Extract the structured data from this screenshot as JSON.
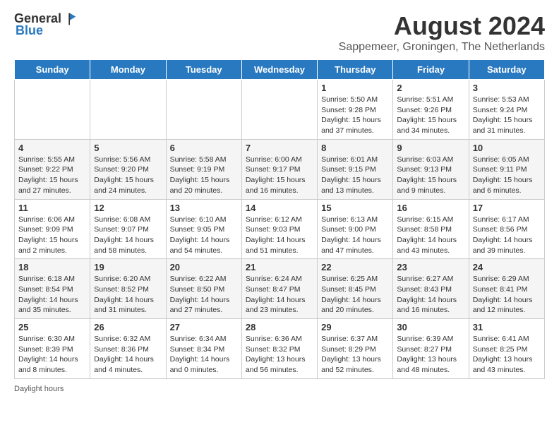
{
  "app": {
    "name": "GeneralBlue",
    "logo_general": "General",
    "logo_blue": "Blue"
  },
  "header": {
    "month_year": "August 2024",
    "location": "Sappemeer, Groningen, The Netherlands"
  },
  "days_of_week": [
    "Sunday",
    "Monday",
    "Tuesday",
    "Wednesday",
    "Thursday",
    "Friday",
    "Saturday"
  ],
  "footer": {
    "daylight_label": "Daylight hours"
  },
  "weeks": [
    [
      {
        "day": "",
        "info": ""
      },
      {
        "day": "",
        "info": ""
      },
      {
        "day": "",
        "info": ""
      },
      {
        "day": "",
        "info": ""
      },
      {
        "day": "1",
        "info": "Sunrise: 5:50 AM\nSunset: 9:28 PM\nDaylight: 15 hours and 37 minutes."
      },
      {
        "day": "2",
        "info": "Sunrise: 5:51 AM\nSunset: 9:26 PM\nDaylight: 15 hours and 34 minutes."
      },
      {
        "day": "3",
        "info": "Sunrise: 5:53 AM\nSunset: 9:24 PM\nDaylight: 15 hours and 31 minutes."
      }
    ],
    [
      {
        "day": "4",
        "info": "Sunrise: 5:55 AM\nSunset: 9:22 PM\nDaylight: 15 hours and 27 minutes."
      },
      {
        "day": "5",
        "info": "Sunrise: 5:56 AM\nSunset: 9:20 PM\nDaylight: 15 hours and 24 minutes."
      },
      {
        "day": "6",
        "info": "Sunrise: 5:58 AM\nSunset: 9:19 PM\nDaylight: 15 hours and 20 minutes."
      },
      {
        "day": "7",
        "info": "Sunrise: 6:00 AM\nSunset: 9:17 PM\nDaylight: 15 hours and 16 minutes."
      },
      {
        "day": "8",
        "info": "Sunrise: 6:01 AM\nSunset: 9:15 PM\nDaylight: 15 hours and 13 minutes."
      },
      {
        "day": "9",
        "info": "Sunrise: 6:03 AM\nSunset: 9:13 PM\nDaylight: 15 hours and 9 minutes."
      },
      {
        "day": "10",
        "info": "Sunrise: 6:05 AM\nSunset: 9:11 PM\nDaylight: 15 hours and 6 minutes."
      }
    ],
    [
      {
        "day": "11",
        "info": "Sunrise: 6:06 AM\nSunset: 9:09 PM\nDaylight: 15 hours and 2 minutes."
      },
      {
        "day": "12",
        "info": "Sunrise: 6:08 AM\nSunset: 9:07 PM\nDaylight: 14 hours and 58 minutes."
      },
      {
        "day": "13",
        "info": "Sunrise: 6:10 AM\nSunset: 9:05 PM\nDaylight: 14 hours and 54 minutes."
      },
      {
        "day": "14",
        "info": "Sunrise: 6:12 AM\nSunset: 9:03 PM\nDaylight: 14 hours and 51 minutes."
      },
      {
        "day": "15",
        "info": "Sunrise: 6:13 AM\nSunset: 9:00 PM\nDaylight: 14 hours and 47 minutes."
      },
      {
        "day": "16",
        "info": "Sunrise: 6:15 AM\nSunset: 8:58 PM\nDaylight: 14 hours and 43 minutes."
      },
      {
        "day": "17",
        "info": "Sunrise: 6:17 AM\nSunset: 8:56 PM\nDaylight: 14 hours and 39 minutes."
      }
    ],
    [
      {
        "day": "18",
        "info": "Sunrise: 6:18 AM\nSunset: 8:54 PM\nDaylight: 14 hours and 35 minutes."
      },
      {
        "day": "19",
        "info": "Sunrise: 6:20 AM\nSunset: 8:52 PM\nDaylight: 14 hours and 31 minutes."
      },
      {
        "day": "20",
        "info": "Sunrise: 6:22 AM\nSunset: 8:50 PM\nDaylight: 14 hours and 27 minutes."
      },
      {
        "day": "21",
        "info": "Sunrise: 6:24 AM\nSunset: 8:47 PM\nDaylight: 14 hours and 23 minutes."
      },
      {
        "day": "22",
        "info": "Sunrise: 6:25 AM\nSunset: 8:45 PM\nDaylight: 14 hours and 20 minutes."
      },
      {
        "day": "23",
        "info": "Sunrise: 6:27 AM\nSunset: 8:43 PM\nDaylight: 14 hours and 16 minutes."
      },
      {
        "day": "24",
        "info": "Sunrise: 6:29 AM\nSunset: 8:41 PM\nDaylight: 14 hours and 12 minutes."
      }
    ],
    [
      {
        "day": "25",
        "info": "Sunrise: 6:30 AM\nSunset: 8:39 PM\nDaylight: 14 hours and 8 minutes."
      },
      {
        "day": "26",
        "info": "Sunrise: 6:32 AM\nSunset: 8:36 PM\nDaylight: 14 hours and 4 minutes."
      },
      {
        "day": "27",
        "info": "Sunrise: 6:34 AM\nSunset: 8:34 PM\nDaylight: 14 hours and 0 minutes."
      },
      {
        "day": "28",
        "info": "Sunrise: 6:36 AM\nSunset: 8:32 PM\nDaylight: 13 hours and 56 minutes."
      },
      {
        "day": "29",
        "info": "Sunrise: 6:37 AM\nSunset: 8:29 PM\nDaylight: 13 hours and 52 minutes."
      },
      {
        "day": "30",
        "info": "Sunrise: 6:39 AM\nSunset: 8:27 PM\nDaylight: 13 hours and 48 minutes."
      },
      {
        "day": "31",
        "info": "Sunrise: 6:41 AM\nSunset: 8:25 PM\nDaylight: 13 hours and 43 minutes."
      }
    ]
  ]
}
